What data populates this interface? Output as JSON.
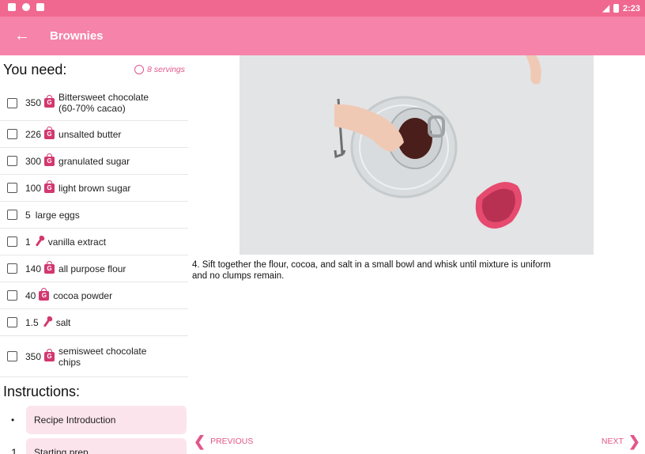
{
  "status": {
    "time": "2:23"
  },
  "appbar": {
    "title": "Brownies"
  },
  "ingredients": {
    "heading": "You need:",
    "servings": "8 servings",
    "items": [
      {
        "qty": "350",
        "unit_icon": "grams-bag-icon",
        "unit_letter": "G",
        "name": "Bittersweet chocolate (60-70% cacao)"
      },
      {
        "qty": "226",
        "unit_icon": "grams-bag-icon",
        "unit_letter": "G",
        "name": "unsalted butter"
      },
      {
        "qty": "300",
        "unit_icon": "grams-bag-icon",
        "unit_letter": "G",
        "name": "granulated sugar"
      },
      {
        "qty": "100",
        "unit_icon": "grams-bag-icon",
        "unit_letter": "G",
        "name": "light brown sugar"
      },
      {
        "qty": "5",
        "unit_icon": "",
        "unit_letter": "",
        "name": "large eggs"
      },
      {
        "qty": "1",
        "unit_icon": "teaspoon-icon",
        "unit_letter": "",
        "name": "vanilla extract"
      },
      {
        "qty": "140",
        "unit_icon": "grams-bag-icon",
        "unit_letter": "G",
        "name": "all purpose flour"
      },
      {
        "qty": "40",
        "unit_icon": "grams-bag-icon",
        "unit_letter": "G",
        "name": "cocoa powder"
      },
      {
        "qty": "1.5",
        "unit_icon": "teaspoon-icon",
        "unit_letter": "",
        "name": "salt"
      },
      {
        "qty": "350",
        "unit_icon": "grams-bag-icon",
        "unit_letter": "G",
        "name": "semisweet chocolate chips"
      }
    ]
  },
  "instructions": {
    "heading": "Instructions:",
    "steps": [
      {
        "marker": "•",
        "label": "Recipe Introduction"
      },
      {
        "marker": "1",
        "label": "Starting prep"
      }
    ]
  },
  "main": {
    "step_text": "4. Sift together the flour, cocoa, and salt in a small bowl and whisk until mixture is uniform and no clumps remain.",
    "prev_label": "PREVIOUS",
    "next_label": "NEXT"
  },
  "colors": {
    "status_bar": "#f0688f",
    "app_bar": "#f683a9",
    "accent": "#e3568a",
    "step_bg": "#fce4ec"
  }
}
